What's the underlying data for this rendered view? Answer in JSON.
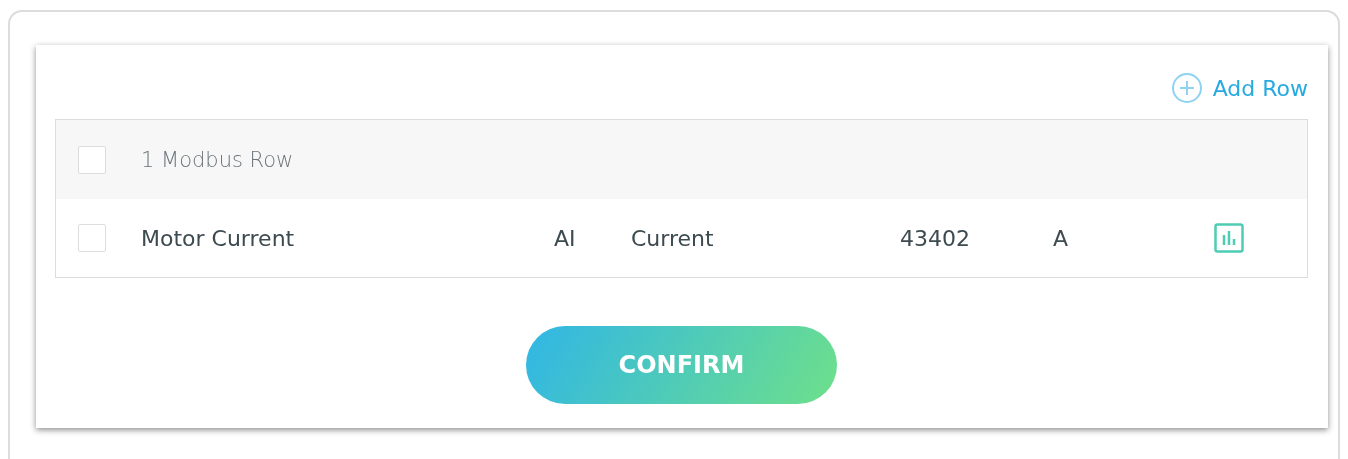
{
  "add_row": {
    "label": "Add Row"
  },
  "table": {
    "header": {
      "checked": false,
      "label": "1 Modbus Row"
    },
    "rows": [
      {
        "checked": false,
        "cells": [
          "Motor Current",
          "AI",
          "Current",
          "43402",
          "A"
        ]
      }
    ]
  },
  "confirm": {
    "label": "CONFIRM"
  }
}
